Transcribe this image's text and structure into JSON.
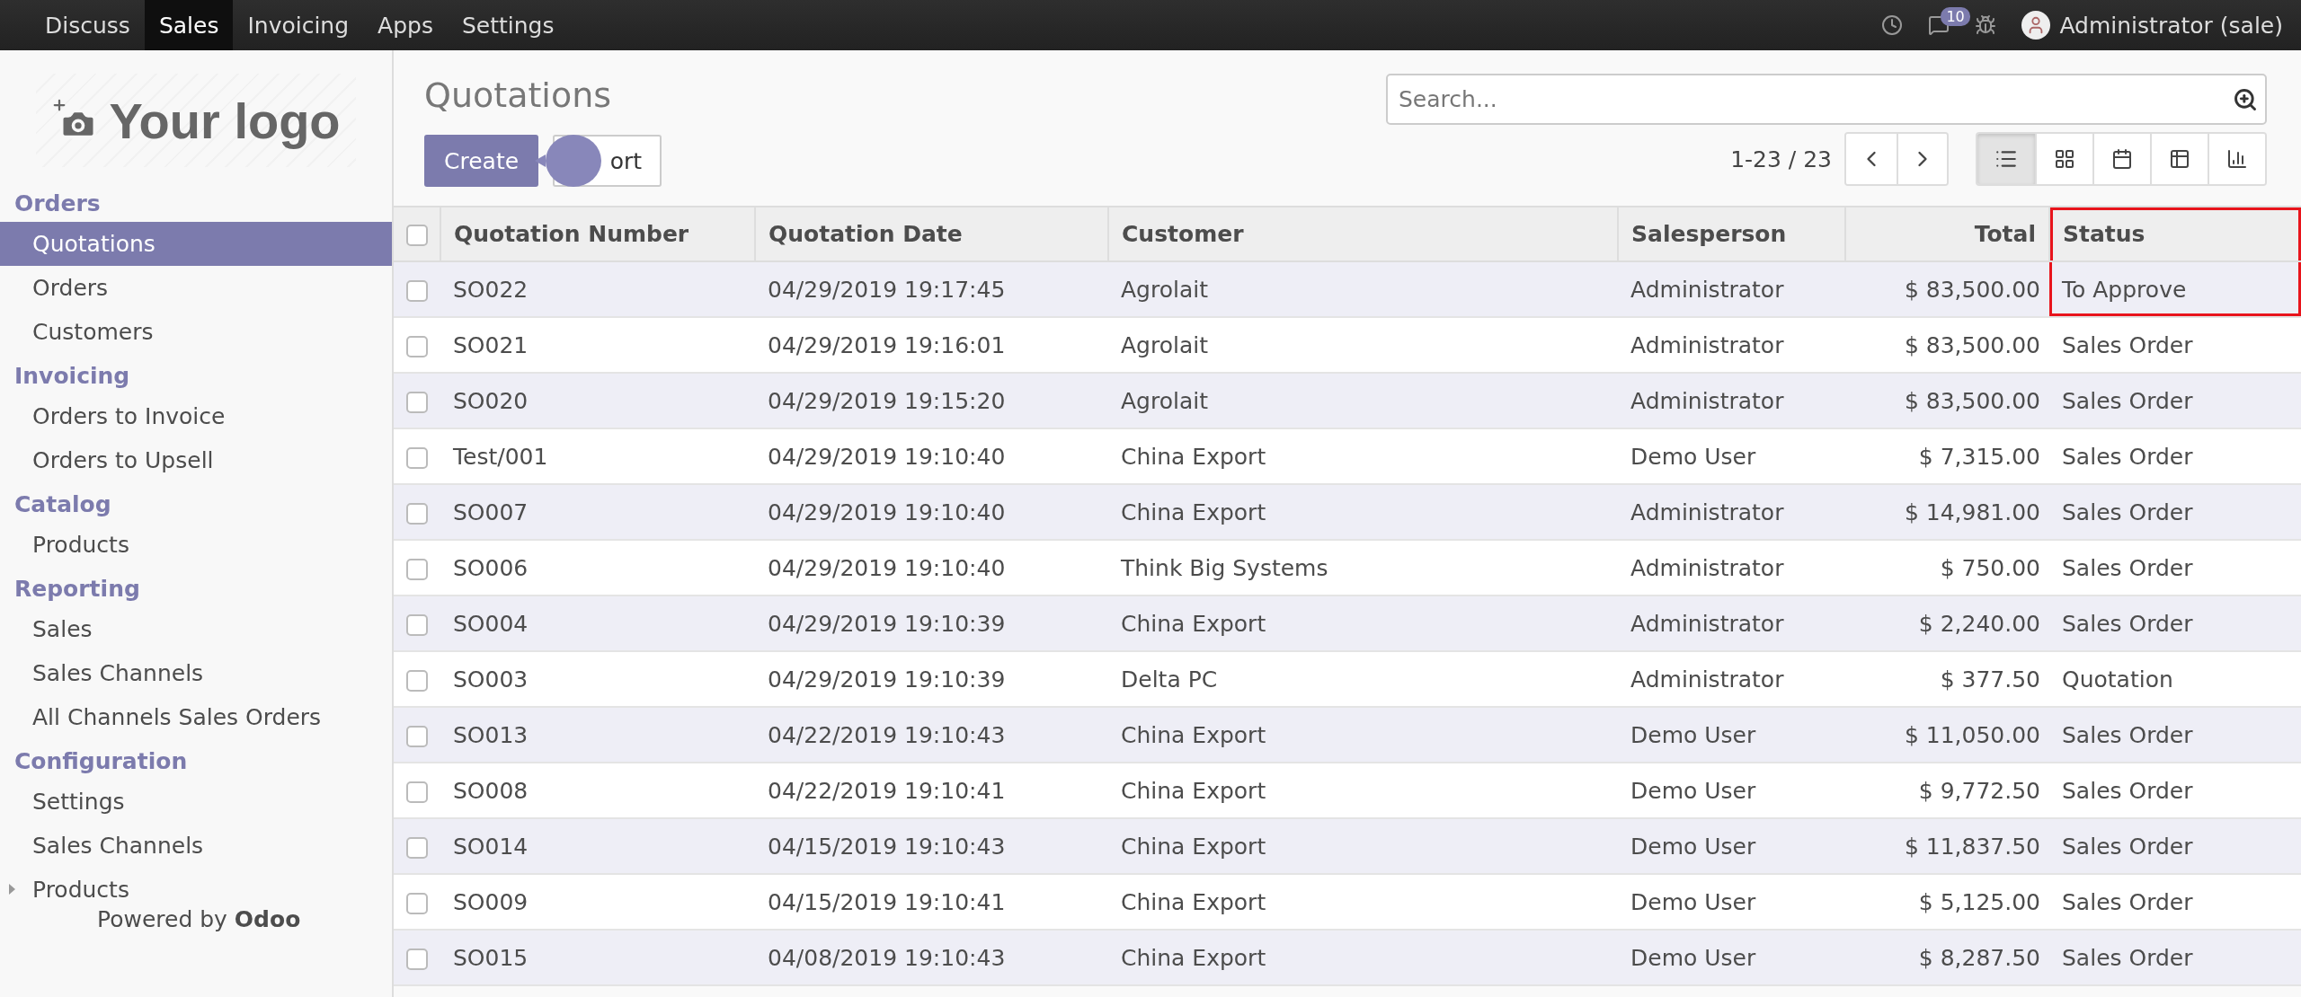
{
  "topbar": {
    "apps": [
      {
        "label": "Discuss",
        "selected": false
      },
      {
        "label": "Sales",
        "selected": true
      },
      {
        "label": "Invoicing",
        "selected": false
      },
      {
        "label": "Apps",
        "selected": false
      },
      {
        "label": "Settings",
        "selected": false
      }
    ],
    "message_count": "10",
    "user": "Administrator (sale)"
  },
  "sidebar": {
    "logo": "Your logo",
    "sections": [
      {
        "title": "Orders",
        "items": [
          {
            "label": "Quotations",
            "selected": true,
            "expandable": false
          },
          {
            "label": "Orders",
            "selected": false,
            "expandable": false
          },
          {
            "label": "Customers",
            "selected": false,
            "expandable": false
          }
        ]
      },
      {
        "title": "Invoicing",
        "items": [
          {
            "label": "Orders to Invoice",
            "selected": false,
            "expandable": false
          },
          {
            "label": "Orders to Upsell",
            "selected": false,
            "expandable": false
          }
        ]
      },
      {
        "title": "Catalog",
        "items": [
          {
            "label": "Products",
            "selected": false,
            "expandable": false
          }
        ]
      },
      {
        "title": "Reporting",
        "items": [
          {
            "label": "Sales",
            "selected": false,
            "expandable": false
          },
          {
            "label": "Sales Channels",
            "selected": false,
            "expandable": false
          },
          {
            "label": "All Channels Sales Orders",
            "selected": false,
            "expandable": false
          }
        ]
      },
      {
        "title": "Configuration",
        "items": [
          {
            "label": "Settings",
            "selected": false,
            "expandable": false
          },
          {
            "label": "Sales Channels",
            "selected": false,
            "expandable": false
          },
          {
            "label": "Products",
            "selected": false,
            "expandable": true
          }
        ]
      }
    ],
    "powered_by": "Powered by **Odoo**"
  },
  "control_panel": {
    "title": "Quotations",
    "create": "Create",
    "import": "ort",
    "search": {
      "placeholder": "Search..."
    },
    "pager": "1-23 / 23",
    "views": [
      {
        "kind": "list",
        "selected": true
      },
      {
        "kind": "kanban",
        "selected": false
      },
      {
        "kind": "calendar",
        "selected": false
      },
      {
        "kind": "pivot",
        "selected": false
      },
      {
        "kind": "graph",
        "selected": false
      }
    ]
  },
  "table": {
    "all_checked": false,
    "columns": [
      {
        "label": "Quotation Number",
        "highlighted": false
      },
      {
        "label": "Quotation Date",
        "highlighted": false
      },
      {
        "label": "Customer",
        "highlighted": false
      },
      {
        "label": "Salesperson",
        "highlighted": false
      },
      {
        "label": "Total",
        "highlighted": false
      },
      {
        "label": "Status",
        "highlighted": true
      }
    ],
    "rows": [
      {
        "checked": false,
        "highlighted": true,
        "cells": [
          "SO022",
          "04/29/2019 19:17:45",
          "Agrolait",
          "Administrator",
          "$ 83,500.00",
          "To Approve"
        ]
      },
      {
        "checked": false,
        "highlighted": false,
        "cells": [
          "SO021",
          "04/29/2019 19:16:01",
          "Agrolait",
          "Administrator",
          "$ 83,500.00",
          "Sales Order"
        ]
      },
      {
        "checked": false,
        "highlighted": false,
        "cells": [
          "SO020",
          "04/29/2019 19:15:20",
          "Agrolait",
          "Administrator",
          "$ 83,500.00",
          "Sales Order"
        ]
      },
      {
        "checked": false,
        "highlighted": false,
        "cells": [
          "Test/001",
          "04/29/2019 19:10:40",
          "China Export",
          "Demo User",
          "$ 7,315.00",
          "Sales Order"
        ]
      },
      {
        "checked": false,
        "highlighted": false,
        "cells": [
          "SO007",
          "04/29/2019 19:10:40",
          "China Export",
          "Administrator",
          "$ 14,981.00",
          "Sales Order"
        ]
      },
      {
        "checked": false,
        "highlighted": false,
        "cells": [
          "SO006",
          "04/29/2019 19:10:40",
          "Think Big Systems",
          "Administrator",
          "$ 750.00",
          "Sales Order"
        ]
      },
      {
        "checked": false,
        "highlighted": false,
        "cells": [
          "SO004",
          "04/29/2019 19:10:39",
          "China Export",
          "Administrator",
          "$ 2,240.00",
          "Sales Order"
        ]
      },
      {
        "checked": false,
        "highlighted": false,
        "cells": [
          "SO003",
          "04/29/2019 19:10:39",
          "Delta PC",
          "Administrator",
          "$ 377.50",
          "Quotation"
        ]
      },
      {
        "checked": false,
        "highlighted": false,
        "cells": [
          "SO013",
          "04/22/2019 19:10:43",
          "China Export",
          "Demo User",
          "$ 11,050.00",
          "Sales Order"
        ]
      },
      {
        "checked": false,
        "highlighted": false,
        "cells": [
          "SO008",
          "04/22/2019 19:10:41",
          "China Export",
          "Demo User",
          "$ 9,772.50",
          "Sales Order"
        ]
      },
      {
        "checked": false,
        "highlighted": false,
        "cells": [
          "SO014",
          "04/15/2019 19:10:43",
          "China Export",
          "Demo User",
          "$ 11,837.50",
          "Sales Order"
        ]
      },
      {
        "checked": false,
        "highlighted": false,
        "cells": [
          "SO009",
          "04/15/2019 19:10:41",
          "China Export",
          "Demo User",
          "$ 5,125.00",
          "Sales Order"
        ]
      },
      {
        "checked": false,
        "highlighted": false,
        "cells": [
          "SO015",
          "04/08/2019 19:10:43",
          "China Export",
          "Demo User",
          "$ 8,287.50",
          "Sales Order"
        ]
      }
    ]
  }
}
